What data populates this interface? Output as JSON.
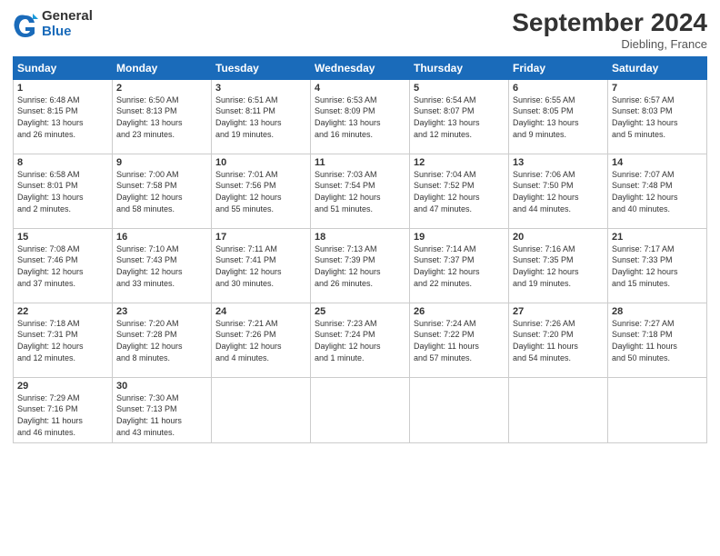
{
  "logo": {
    "general": "General",
    "blue": "Blue"
  },
  "title": "September 2024",
  "location": "Diebling, France",
  "days_of_week": [
    "Sunday",
    "Monday",
    "Tuesday",
    "Wednesday",
    "Thursday",
    "Friday",
    "Saturday"
  ],
  "weeks": [
    [
      {
        "day": "1",
        "detail": "Sunrise: 6:48 AM\nSunset: 8:15 PM\nDaylight: 13 hours\nand 26 minutes."
      },
      {
        "day": "2",
        "detail": "Sunrise: 6:50 AM\nSunset: 8:13 PM\nDaylight: 13 hours\nand 23 minutes."
      },
      {
        "day": "3",
        "detail": "Sunrise: 6:51 AM\nSunset: 8:11 PM\nDaylight: 13 hours\nand 19 minutes."
      },
      {
        "day": "4",
        "detail": "Sunrise: 6:53 AM\nSunset: 8:09 PM\nDaylight: 13 hours\nand 16 minutes."
      },
      {
        "day": "5",
        "detail": "Sunrise: 6:54 AM\nSunset: 8:07 PM\nDaylight: 13 hours\nand 12 minutes."
      },
      {
        "day": "6",
        "detail": "Sunrise: 6:55 AM\nSunset: 8:05 PM\nDaylight: 13 hours\nand 9 minutes."
      },
      {
        "day": "7",
        "detail": "Sunrise: 6:57 AM\nSunset: 8:03 PM\nDaylight: 13 hours\nand 5 minutes."
      }
    ],
    [
      {
        "day": "8",
        "detail": "Sunrise: 6:58 AM\nSunset: 8:01 PM\nDaylight: 13 hours\nand 2 minutes."
      },
      {
        "day": "9",
        "detail": "Sunrise: 7:00 AM\nSunset: 7:58 PM\nDaylight: 12 hours\nand 58 minutes."
      },
      {
        "day": "10",
        "detail": "Sunrise: 7:01 AM\nSunset: 7:56 PM\nDaylight: 12 hours\nand 55 minutes."
      },
      {
        "day": "11",
        "detail": "Sunrise: 7:03 AM\nSunset: 7:54 PM\nDaylight: 12 hours\nand 51 minutes."
      },
      {
        "day": "12",
        "detail": "Sunrise: 7:04 AM\nSunset: 7:52 PM\nDaylight: 12 hours\nand 47 minutes."
      },
      {
        "day": "13",
        "detail": "Sunrise: 7:06 AM\nSunset: 7:50 PM\nDaylight: 12 hours\nand 44 minutes."
      },
      {
        "day": "14",
        "detail": "Sunrise: 7:07 AM\nSunset: 7:48 PM\nDaylight: 12 hours\nand 40 minutes."
      }
    ],
    [
      {
        "day": "15",
        "detail": "Sunrise: 7:08 AM\nSunset: 7:46 PM\nDaylight: 12 hours\nand 37 minutes."
      },
      {
        "day": "16",
        "detail": "Sunrise: 7:10 AM\nSunset: 7:43 PM\nDaylight: 12 hours\nand 33 minutes."
      },
      {
        "day": "17",
        "detail": "Sunrise: 7:11 AM\nSunset: 7:41 PM\nDaylight: 12 hours\nand 30 minutes."
      },
      {
        "day": "18",
        "detail": "Sunrise: 7:13 AM\nSunset: 7:39 PM\nDaylight: 12 hours\nand 26 minutes."
      },
      {
        "day": "19",
        "detail": "Sunrise: 7:14 AM\nSunset: 7:37 PM\nDaylight: 12 hours\nand 22 minutes."
      },
      {
        "day": "20",
        "detail": "Sunrise: 7:16 AM\nSunset: 7:35 PM\nDaylight: 12 hours\nand 19 minutes."
      },
      {
        "day": "21",
        "detail": "Sunrise: 7:17 AM\nSunset: 7:33 PM\nDaylight: 12 hours\nand 15 minutes."
      }
    ],
    [
      {
        "day": "22",
        "detail": "Sunrise: 7:18 AM\nSunset: 7:31 PM\nDaylight: 12 hours\nand 12 minutes."
      },
      {
        "day": "23",
        "detail": "Sunrise: 7:20 AM\nSunset: 7:28 PM\nDaylight: 12 hours\nand 8 minutes."
      },
      {
        "day": "24",
        "detail": "Sunrise: 7:21 AM\nSunset: 7:26 PM\nDaylight: 12 hours\nand 4 minutes."
      },
      {
        "day": "25",
        "detail": "Sunrise: 7:23 AM\nSunset: 7:24 PM\nDaylight: 12 hours\nand 1 minute."
      },
      {
        "day": "26",
        "detail": "Sunrise: 7:24 AM\nSunset: 7:22 PM\nDaylight: 11 hours\nand 57 minutes."
      },
      {
        "day": "27",
        "detail": "Sunrise: 7:26 AM\nSunset: 7:20 PM\nDaylight: 11 hours\nand 54 minutes."
      },
      {
        "day": "28",
        "detail": "Sunrise: 7:27 AM\nSunset: 7:18 PM\nDaylight: 11 hours\nand 50 minutes."
      }
    ],
    [
      {
        "day": "29",
        "detail": "Sunrise: 7:29 AM\nSunset: 7:16 PM\nDaylight: 11 hours\nand 46 minutes."
      },
      {
        "day": "30",
        "detail": "Sunrise: 7:30 AM\nSunset: 7:13 PM\nDaylight: 11 hours\nand 43 minutes."
      },
      {
        "day": "",
        "detail": ""
      },
      {
        "day": "",
        "detail": ""
      },
      {
        "day": "",
        "detail": ""
      },
      {
        "day": "",
        "detail": ""
      },
      {
        "day": "",
        "detail": ""
      }
    ]
  ]
}
